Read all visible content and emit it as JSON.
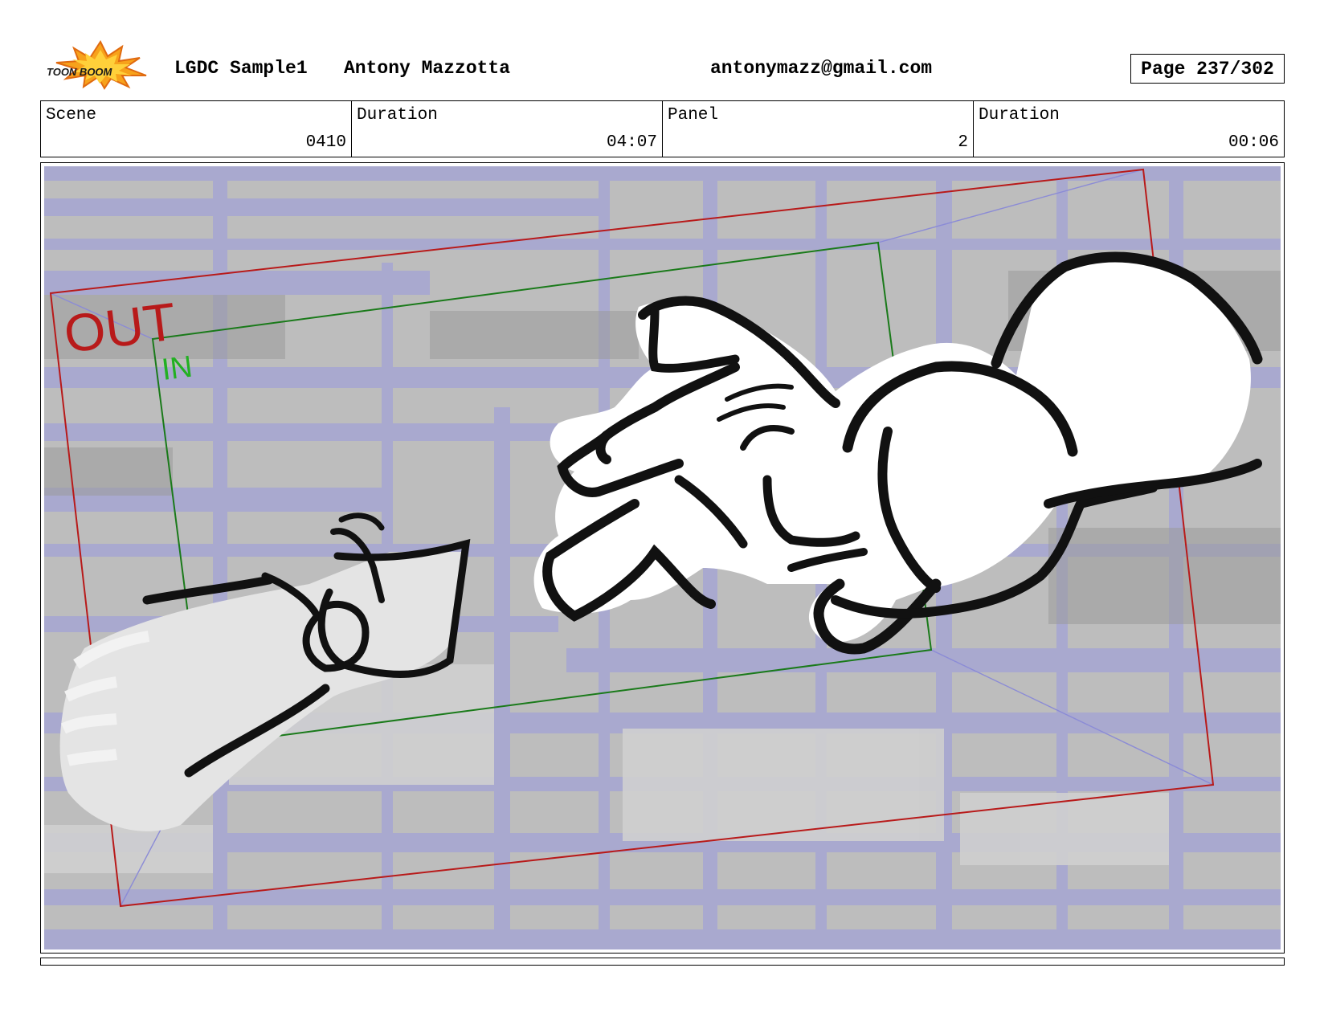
{
  "header": {
    "logo_text": "TOON BOOM",
    "project": "LGDC Sample1",
    "author": "Antony Mazzotta",
    "email": "antonymazz@gmail.com",
    "page_label": "Page 237/302"
  },
  "info": {
    "scene_label": "Scene",
    "scene_value": "0410",
    "scene_duration_label": "Duration",
    "scene_duration_value": "04:07",
    "panel_label": "Panel",
    "panel_value": "2",
    "panel_duration_label": "Duration",
    "panel_duration_value": "00:06"
  },
  "panel": {
    "out_label": "OUT",
    "in_label": "IN",
    "colors": {
      "out_frame": "#b81a1a",
      "in_frame": "#1a7a1a",
      "in_text": "#22b022",
      "background_blue": "#a9a9cf",
      "background_gray": "#bdbdbd"
    }
  }
}
